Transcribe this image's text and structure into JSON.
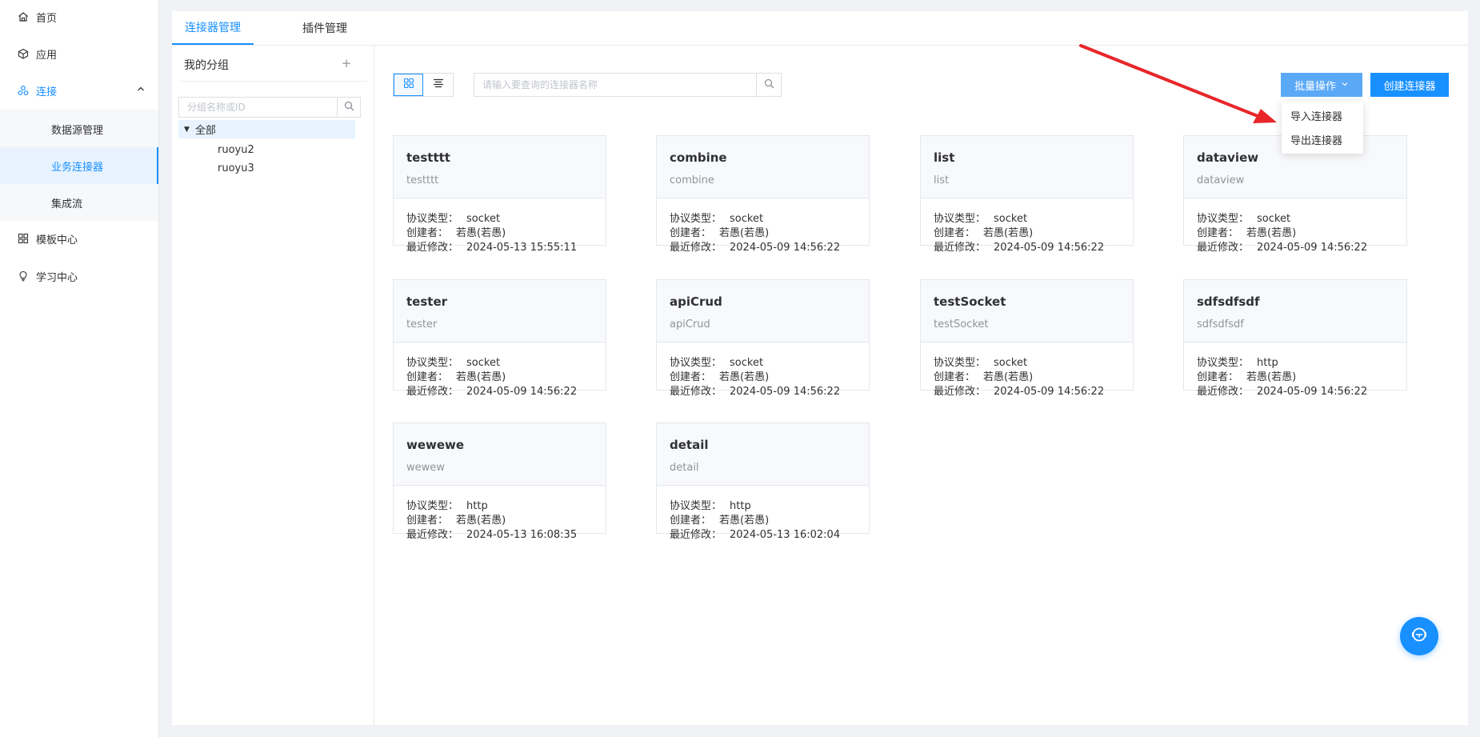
{
  "sidebar": {
    "items": [
      {
        "label": "首页",
        "icon": "home-icon"
      },
      {
        "label": "应用",
        "icon": "cube-icon"
      },
      {
        "label": "连接",
        "icon": "connect-icon"
      },
      {
        "label": "模板中心",
        "icon": "grid-icon"
      },
      {
        "label": "学习中心",
        "icon": "bulb-icon"
      }
    ],
    "sub_items": [
      {
        "label": "数据源管理"
      },
      {
        "label": "业务连接器"
      },
      {
        "label": "集成流"
      }
    ]
  },
  "tabs": [
    {
      "label": "连接器管理"
    },
    {
      "label": "插件管理"
    }
  ],
  "groups": {
    "title": "我的分组",
    "add_label": "+",
    "search_placeholder": "分组名称或ID",
    "root": "全部",
    "children": [
      "ruoyu2",
      "ruoyu3"
    ]
  },
  "toolbar": {
    "search_placeholder": "请输入要查询的连接器名称",
    "batch_label": "批量操作",
    "create_label": "创建连接器"
  },
  "dropdown": {
    "items": [
      "导入连接器",
      "导出连接器"
    ]
  },
  "labels": {
    "protocol": "协议类型：",
    "creator": "创建者：",
    "modified": "最近修改："
  },
  "connectors": [
    {
      "name": "testttt",
      "id": "testttt",
      "protocol": "socket",
      "creator": "若愚(若愚)",
      "modified": "2024-05-13 15:55:11"
    },
    {
      "name": "combine",
      "id": "combine",
      "protocol": "socket",
      "creator": "若愚(若愚)",
      "modified": "2024-05-09 14:56:22"
    },
    {
      "name": "list",
      "id": "list",
      "protocol": "socket",
      "creator": "若愚(若愚)",
      "modified": "2024-05-09 14:56:22"
    },
    {
      "name": "dataview",
      "id": "dataview",
      "protocol": "socket",
      "creator": "若愚(若愚)",
      "modified": "2024-05-09 14:56:22"
    },
    {
      "name": "tester",
      "id": "tester",
      "protocol": "socket",
      "creator": "若愚(若愚)",
      "modified": "2024-05-09 14:56:22"
    },
    {
      "name": "apiCrud",
      "id": "apiCrud",
      "protocol": "socket",
      "creator": "若愚(若愚)",
      "modified": "2024-05-09 14:56:22"
    },
    {
      "name": "testSocket",
      "id": "testSocket",
      "protocol": "socket",
      "creator": "若愚(若愚)",
      "modified": "2024-05-09 14:56:22"
    },
    {
      "name": "sdfsdfsdf",
      "id": "sdfsdfsdf",
      "protocol": "http",
      "creator": "若愚(若愚)",
      "modified": "2024-05-09 14:56:22"
    },
    {
      "name": "wewewe",
      "id": "wewew",
      "protocol": "http",
      "creator": "若愚(若愚)",
      "modified": "2024-05-13 16:08:35"
    },
    {
      "name": "detail",
      "id": "detail",
      "protocol": "http",
      "creator": "若愚(若愚)",
      "modified": "2024-05-13 16:02:04"
    }
  ],
  "colors": {
    "primary": "#1890ff",
    "batch_button": "#5aa9f7",
    "annotation_arrow": "#e8262a"
  }
}
